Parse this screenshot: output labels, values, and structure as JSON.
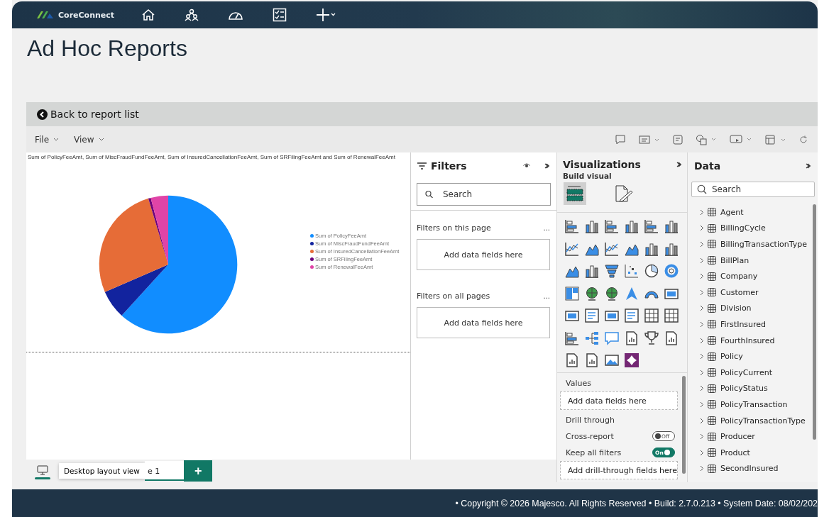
{
  "header": {
    "brand": "CoreConnect"
  },
  "page_title": "Ad Hoc Reports",
  "back_link": "Back to report list",
  "menu": [
    {
      "label": "File"
    },
    {
      "label": "View"
    }
  ],
  "report": {
    "chart_title": "Sum of PolicyFeeAmt, Sum of MiscFraudFundFeeAmt, Sum of InsuredCancellationFeeAmt, Sum of SRFilingFeeAmt and Sum of RenewalFeeAmt",
    "legend": [
      {
        "label": "Sum of PolicyFeeAmt",
        "color": "#118dff"
      },
      {
        "label": "Sum of MiscFraudFundFeeAmt",
        "color": "#12239e"
      },
      {
        "label": "Sum of InsuredCancellationFeeAmt",
        "color": "#e66c37"
      },
      {
        "label": "Sum of SRFilingFeeAmt",
        "color": "#6b007b"
      },
      {
        "label": "Sum of RenewalFeeAmt",
        "color": "#e044a7"
      }
    ]
  },
  "filters": {
    "title": "Filters",
    "search": {
      "placeholder": "Search"
    },
    "sections": [
      {
        "label": "Filters on this page",
        "more": "...",
        "drop": "Add data fields here"
      },
      {
        "label": "Filters on all pages",
        "more": "...",
        "drop": "Add data fields here"
      }
    ]
  },
  "visualizations": {
    "title": "Visualizations",
    "subtitle": "Build visual",
    "values_label": "Values",
    "values_drop": "Add data fields here",
    "drill_label": "Drill through",
    "toggles": [
      {
        "label": "Cross-report",
        "on": false,
        "state_text": "Off"
      },
      {
        "label": "Keep all filters",
        "on": true,
        "state_text": "On"
      }
    ],
    "drill_drop": "Add drill-through fields here"
  },
  "data": {
    "title": "Data",
    "search": {
      "placeholder": "Search"
    },
    "tables": [
      {
        "name": "Agent",
        "expanded": false
      },
      {
        "name": "BillingCycle",
        "expanded": false
      },
      {
        "name": "BillingTransactionType",
        "expanded": false
      },
      {
        "name": "BillPlan",
        "expanded": false
      },
      {
        "name": "Company",
        "expanded": false
      },
      {
        "name": "Customer",
        "expanded": false
      },
      {
        "name": "Division",
        "expanded": false
      },
      {
        "name": "FirstInsured",
        "expanded": false
      },
      {
        "name": "FourthInsured",
        "expanded": false
      },
      {
        "name": "Policy",
        "expanded": false
      },
      {
        "name": "PolicyCurrent",
        "expanded": false
      },
      {
        "name": "PolicyStatus",
        "expanded": false
      },
      {
        "name": "PolicyTransaction",
        "expanded": false
      },
      {
        "name": "PolicyTransactionType",
        "expanded": false
      },
      {
        "name": "Producer",
        "expanded": false
      },
      {
        "name": "Product",
        "expanded": false
      },
      {
        "name": "SecondInsured",
        "expanded": false
      }
    ]
  },
  "page_tabs": [
    {
      "label": "e 1",
      "selected": true
    }
  ],
  "tooltip": "Desktop layout view",
  "add_page": "+",
  "footer": "• Copyright © 2026 Majesco. All Rights Reserved • Build: 2.7.0.213 • System Date: 08/02/202"
}
